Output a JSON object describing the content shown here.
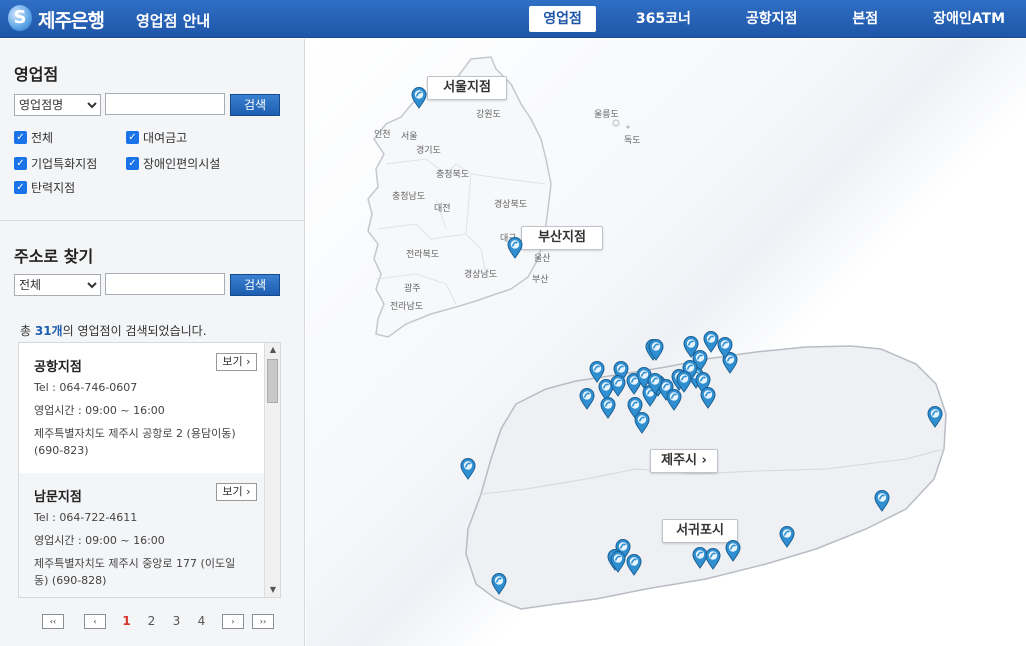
{
  "header": {
    "logo_mark": "S",
    "logo_text": "제주은행",
    "title": "영업점 안내",
    "nav": [
      "영업점",
      "365코너",
      "공항지점",
      "본점",
      "장애인ATM"
    ]
  },
  "branch_search": {
    "title": "영업점",
    "select_value": "영업점명",
    "button": "검색",
    "checkboxes": [
      "전체",
      "대여금고",
      "기업특화지점",
      "장애인편의시설",
      "탄력지점"
    ]
  },
  "address_search": {
    "title": "주소로 찾기",
    "select_value": "전체",
    "button": "검색"
  },
  "result": {
    "prefix": "총 ",
    "count": "31개",
    "suffix": "의 영업점이 검색되었습니다."
  },
  "branches": [
    {
      "name": "공항지점",
      "view": "보기 ›",
      "tel": "Tel : 064-746-0607",
      "hours": "영업시간 : 09:00 ~ 16:00",
      "address": "제주특별자치도 제주시 공항로 2 (용담이동) (690-823)"
    },
    {
      "name": "남문지점",
      "view": "보기 ›",
      "tel": "Tel : 064-722-4611",
      "hours": "영업시간 : 09:00 ~ 16:00",
      "address": "제주특별자치도 제주시 중앙로 177 (이도일동) (690-828)"
    }
  ],
  "pagination": {
    "first": "‹‹",
    "prev": "‹",
    "pages": [
      "1",
      "2",
      "3",
      "4"
    ],
    "current": "1",
    "next": "›",
    "last": "››"
  },
  "map": {
    "labels": [
      "서울지점",
      "부산지점",
      "제주시 ›",
      "서귀포시 ›"
    ],
    "regions": [
      "강원도",
      "인천",
      "서울",
      "경기도",
      "충청북도",
      "충청남도",
      "대전",
      "경상북도",
      "대구",
      "전라북도",
      "경상남도",
      "울산",
      "부산",
      "광주",
      "전라남도",
      "울릉도",
      "독도"
    ],
    "pin_color": "#2f8fd0"
  }
}
